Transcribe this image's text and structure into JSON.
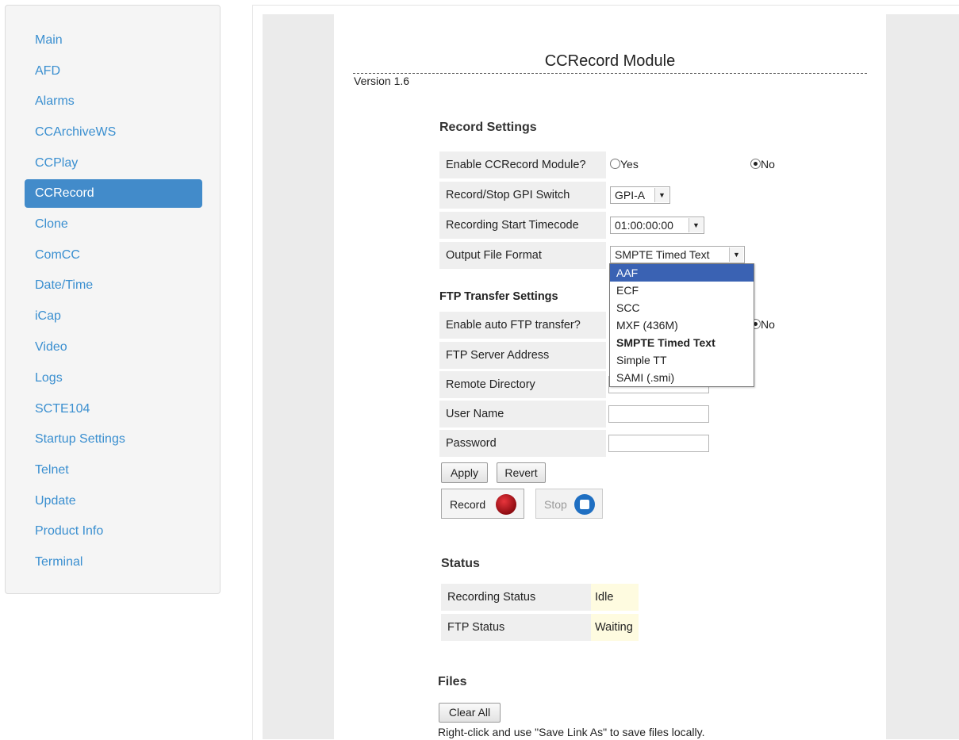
{
  "sidebar": {
    "items": [
      {
        "label": "Main"
      },
      {
        "label": "AFD"
      },
      {
        "label": "Alarms"
      },
      {
        "label": "CCArchiveWS"
      },
      {
        "label": "CCPlay"
      },
      {
        "label": "CCRecord",
        "active": true
      },
      {
        "label": "Clone"
      },
      {
        "label": "ComCC"
      },
      {
        "label": "Date/Time"
      },
      {
        "label": "iCap"
      },
      {
        "label": "Video"
      },
      {
        "label": "Logs"
      },
      {
        "label": "SCTE104"
      },
      {
        "label": "Startup Settings"
      },
      {
        "label": "Telnet"
      },
      {
        "label": "Update"
      },
      {
        "label": "Product Info"
      },
      {
        "label": "Terminal"
      }
    ]
  },
  "page": {
    "title": "CCRecord Module",
    "version": "Version 1.6"
  },
  "record_settings": {
    "heading": "Record Settings",
    "enable_label": "Enable CCRecord Module?",
    "yes_label": "Yes",
    "no_label": "No",
    "enable_value": "No",
    "gpi_label": "Record/Stop GPI Switch",
    "gpi_value": "GPI-A",
    "timecode_label": "Recording Start Timecode",
    "timecode_value": "01:00:00:00",
    "format_label": "Output File Format",
    "format_value": "SMPTE Timed Text",
    "format_options": [
      "AAF",
      "ECF",
      "SCC",
      "MXF (436M)",
      "SMPTE Timed Text",
      "Simple TT",
      "SAMI (.smi)"
    ],
    "format_highlighted": "AAF"
  },
  "ftp_settings": {
    "heading": "FTP Transfer Settings",
    "auto_label": "Enable auto FTP transfer?",
    "no_label": "No",
    "server_label": "FTP Server Address",
    "dir_label": "Remote Directory",
    "user_label": "User Name",
    "password_label": "Password"
  },
  "actions": {
    "apply_label": "Apply",
    "revert_label": "Revert",
    "record_label": "Record",
    "stop_label": "Stop"
  },
  "status": {
    "heading": "Status",
    "recording_label": "Recording Status",
    "recording_value": "Idle",
    "ftp_label": "FTP Status",
    "ftp_value": "Waiting"
  },
  "files": {
    "heading": "Files",
    "clear_label": "Clear All",
    "hint": "Right-click and use \"Save Link As\" to save files locally."
  },
  "colors": {
    "nav_active": "#428bca",
    "nav_link": "#3a8fd0",
    "dropdown_highlight": "#3a62b3",
    "record_icon": "#c0151d",
    "stop_icon": "#1f6fc2"
  }
}
